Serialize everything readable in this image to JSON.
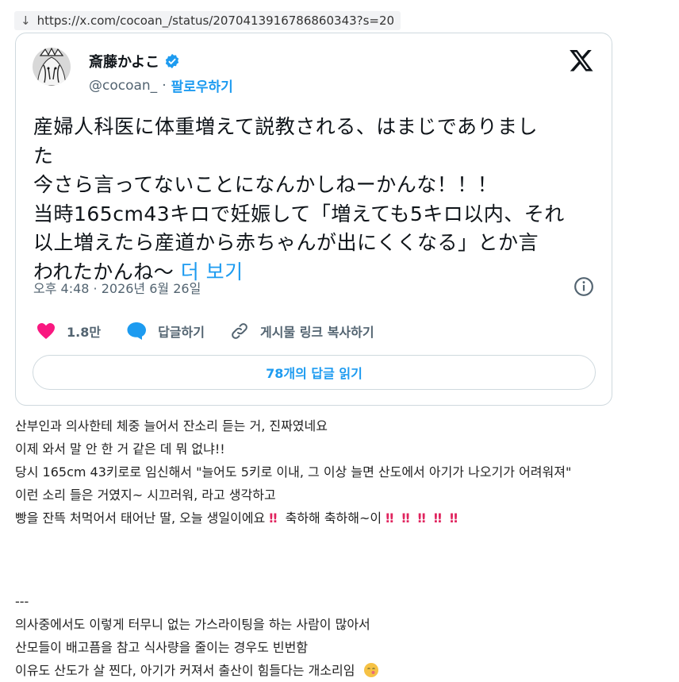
{
  "url_bar": {
    "arrow": "↓",
    "url": "https://x.com/cocoan_/status/2070413916786860343?s=20"
  },
  "tweet": {
    "author_name": "斎藤かよこ",
    "handle": "@cocoan_",
    "separator": "·",
    "follow_label": "팔로우하기",
    "text_lines": [
      "産婦人科医に体重増えて説教される、はまじでありまし",
      "た",
      "今さら言ってないことになんかしねーかんな！！！",
      "当時165cm43キロで妊娠して「増えても5キロ以内、それ",
      "以上増えたら産道から赤ちゃんが出にくくなる」とか言"
    ],
    "last_line": "われたかんね〜",
    "more_label": "더 보기",
    "timestamp": "오후 4:48 · 2026년 6월 26일",
    "likes": "1.8만",
    "reply_label": "답글하기",
    "copy_link_label": "게시물 링크 복사하기",
    "read_replies_label": "78개의 답글 읽기",
    "colors": {
      "accent": "#1d9bf0",
      "like": "#f91880",
      "muted": "#536471"
    }
  },
  "body": {
    "lines": [
      "산부인과 의사한테 체중 늘어서 잔소리 듣는 거, 진짜였네요",
      "이제 와서 말 안 한 거 같은 데 뭐 없냐!!",
      "당시 165cm 43키로로 임신해서 \"늘어도 5키로 이내, 그 이상 늘면 산도에서 아기가 나오기가 어려워져\"",
      "이런 소리 들은 거였지~ 시끄러워, 라고 생각하고"
    ],
    "birthday_line_a": "빵을 잔뜩 처먹어서 태어난 딸, 오늘 생일이에요",
    "birthday_line_b": "축하해 축하해~이",
    "bang": "‼",
    "separator": "---",
    "lines2": [
      "의사중에서도 이렇게 터무니 없는 가스라이팅을 하는 사람이 많아서",
      "산모들이 배고픔을 참고 식사량을 줄이는 경우도 빈번함"
    ],
    "last_line": "이유도 산도가 살 찐다, 아기가 커져서 출산이 힘들다는 개소리임"
  }
}
